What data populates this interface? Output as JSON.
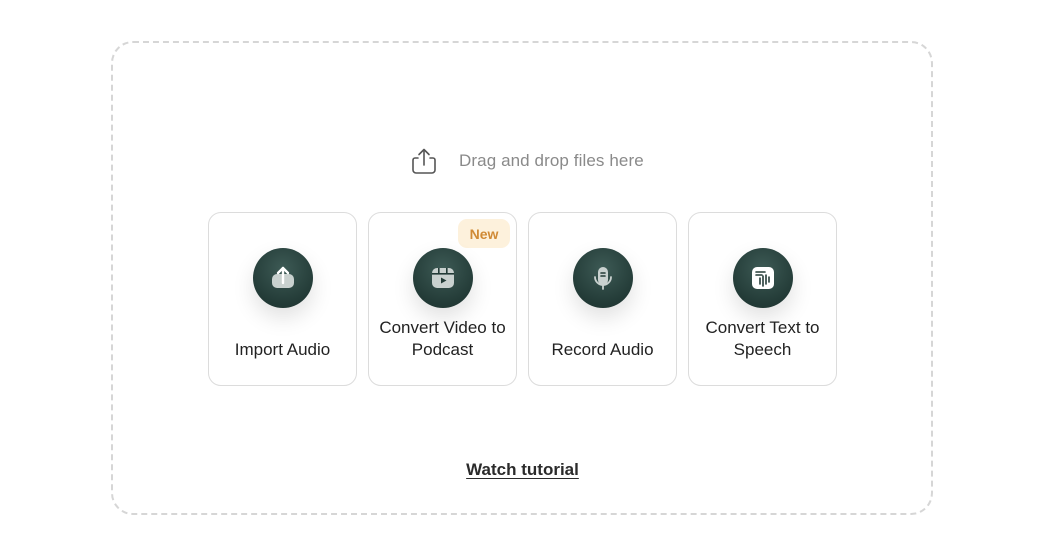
{
  "dropzone": {
    "drag_text": "Drag and drop files here",
    "icon": "upload-tray-icon"
  },
  "cards": [
    {
      "id": "import-audio",
      "label": "Import Audio",
      "icon": "upload-icon",
      "badge": ""
    },
    {
      "id": "convert-video",
      "label": "Convert Video to Podcast",
      "icon": "video-play-icon",
      "badge": "New"
    },
    {
      "id": "record-audio",
      "label": "Record Audio",
      "icon": "microphone-icon",
      "badge": ""
    },
    {
      "id": "text-to-speech",
      "label": "Convert Text to Speech",
      "icon": "text-speech-icon",
      "badge": ""
    }
  ],
  "footer": {
    "tutorial_link": "Watch tutorial"
  },
  "colors": {
    "icon_circle": "#233b37",
    "badge_bg": "#fdf1dc",
    "badge_text": "#d08a35",
    "border": "#dcdcdc"
  }
}
